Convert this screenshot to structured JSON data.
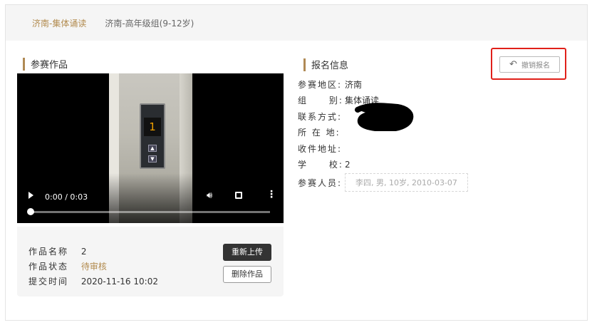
{
  "tabs": [
    {
      "label": "济南-集体诵读",
      "active": true
    },
    {
      "label": "济南-高年级组(9-12岁)",
      "active": false
    }
  ],
  "entry_section": {
    "title": "参赛作品"
  },
  "video": {
    "time": "0:00 / 0:03",
    "progress": 0,
    "elevator_floor": "1"
  },
  "work": {
    "name_label": "作品名称",
    "name_value": "2",
    "status_label": "作品状态",
    "status_value": "待审核",
    "submit_label": "提交时间",
    "submit_value": "2020-11-16 10:02",
    "reupload_label": "重新上传",
    "delete_label": "删除作品"
  },
  "registration": {
    "title": "报名信息",
    "cancel_label": "撤销报名",
    "fields": [
      {
        "label": "参赛地区:",
        "value": "济南"
      },
      {
        "label": "组 别:",
        "value": "集体诵读"
      },
      {
        "label": "联系方式:",
        "value": ""
      },
      {
        "label": "所 在 地:",
        "value": ""
      },
      {
        "label": "收件地址:",
        "value": ""
      },
      {
        "label": "学 校:",
        "value": "2"
      }
    ],
    "members_label": "参赛人员:",
    "members_value": "李四, 男, 10岁, 2010-03-07"
  },
  "colors": {
    "accent": "#b28b4f",
    "highlight": "#e0201a"
  }
}
